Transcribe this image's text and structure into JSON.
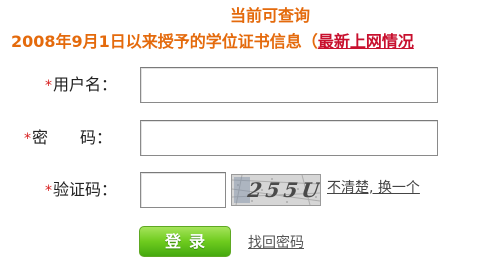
{
  "header": {
    "line1": "当前可查询",
    "line2_prefix": "2008年9月1日以来授予的学位证书信息（",
    "line2_link": "最新上网情况"
  },
  "form": {
    "required_mark": "*",
    "username_label": "用户名：",
    "username_value": "",
    "password_label": "密　　码：",
    "password_value": "",
    "captcha_label": "验证码：",
    "captcha_value": "",
    "captcha_image_text": "255U",
    "refresh_label": "不清楚, 换一个",
    "login_label": "登录",
    "forgot_label": "找回密码"
  },
  "colors": {
    "header_orange": "#e46a0c",
    "link_red": "#c8102e",
    "required_red": "#d71e1e",
    "button_green": "#6ecb1e"
  }
}
